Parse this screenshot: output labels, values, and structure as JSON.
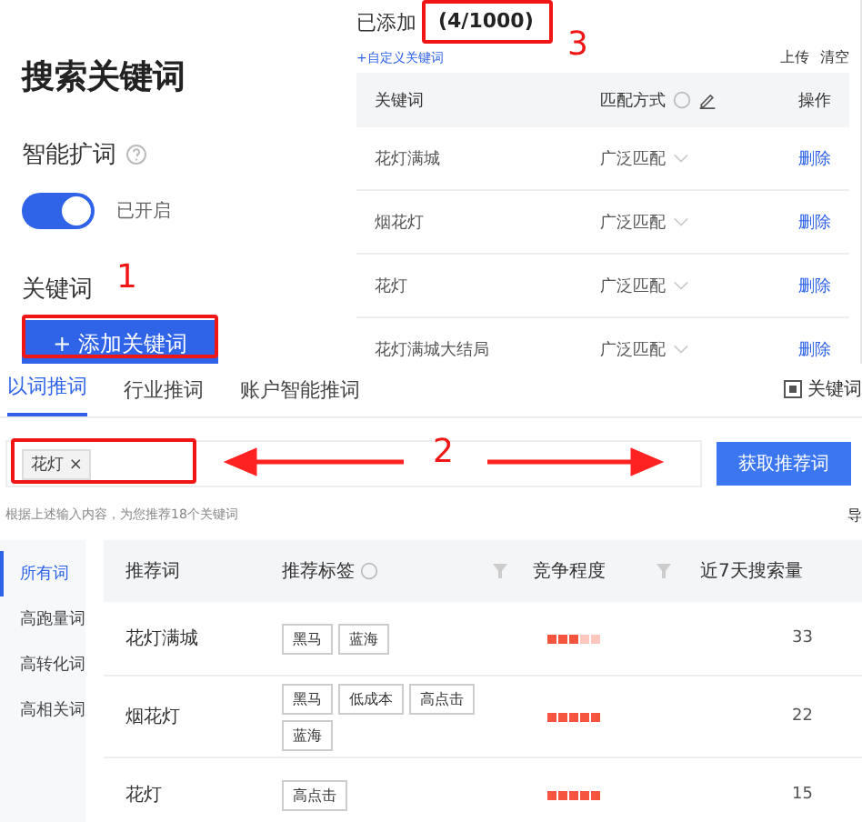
{
  "left": {
    "title": "搜索关键词",
    "smart_expand": {
      "label": "智能扩词",
      "on": true,
      "status": "已开启"
    },
    "keyword_label": "关键词",
    "add_button": "+ 添加关键词"
  },
  "added": {
    "title": "已添加",
    "count": "(4/1000)",
    "custom_link": "+自定义关键词",
    "actions": [
      "上传",
      "清空"
    ],
    "columns": [
      "关键词",
      "匹配方式",
      "操作"
    ],
    "rows": [
      {
        "keyword": "花灯满城",
        "match": "广泛匹配",
        "action": "删除"
      },
      {
        "keyword": "烟花灯",
        "match": "广泛匹配",
        "action": "删除"
      },
      {
        "keyword": "花灯",
        "match": "广泛匹配",
        "action": "删除"
      },
      {
        "keyword": "花灯满城大结局",
        "match": "广泛匹配",
        "action": "删除"
      }
    ]
  },
  "recommend": {
    "tabs": [
      {
        "label": "以词推词",
        "selected": true
      },
      {
        "label": "行业推词",
        "selected": false
      },
      {
        "label": "账户智能推词",
        "selected": false
      }
    ],
    "column_toggle": "关键词",
    "tags": [
      {
        "label": "花灯",
        "close": "×"
      }
    ],
    "fetch_button": "获取推荐词",
    "hint": "根据上述输入内容，为您推荐18个关键词",
    "export_cut": "导",
    "categories": [
      {
        "label": "所有词",
        "selected": true
      },
      {
        "label": "高跑量词",
        "selected": false
      },
      {
        "label": "高转化词",
        "selected": false
      },
      {
        "label": "高相关词",
        "selected": false
      }
    ],
    "columns": [
      "推荐词",
      "推荐标签",
      "竞争程度",
      "近7天搜索量"
    ],
    "rows": [
      {
        "word": "花灯满城",
        "tags": [
          "黑马",
          "蓝海"
        ],
        "stars": 3,
        "volume": "33"
      },
      {
        "word": "烟花灯",
        "tags": [
          "黑马",
          "低成本",
          "高点击",
          "蓝海"
        ],
        "stars": 5,
        "volume": "22"
      },
      {
        "word": "花灯",
        "tags": [
          "高点击"
        ],
        "stars": 5,
        "volume": "15"
      }
    ]
  },
  "annotations": [
    {
      "label": "1"
    },
    {
      "label": "2"
    },
    {
      "label": "3"
    }
  ]
}
